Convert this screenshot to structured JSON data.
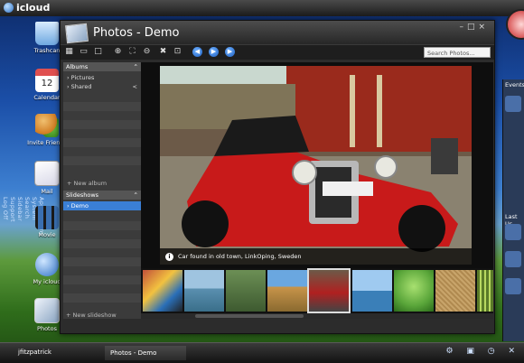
{
  "desktop": {
    "brand": "icloud",
    "vertical_menu": [
      "Applications",
      "System",
      "Search",
      "Sidebar",
      "Support",
      "Log Off"
    ],
    "icons": [
      {
        "name": "trashcan-icon",
        "label": "Trashcan",
        "color": "#6fa8e0"
      },
      {
        "name": "calendar-icon",
        "label": "Calendar",
        "color": "#e05050"
      },
      {
        "name": "invite-friends-icon",
        "label": "Invite Friends",
        "color": "#f0a830"
      },
      {
        "name": "mail-icon",
        "label": "Mail",
        "color": "#eaeaea"
      },
      {
        "name": "movie-icon",
        "label": "Movie",
        "color": "#3a6fb0"
      },
      {
        "name": "my-icloud-icon",
        "label": "My icloud",
        "color": "#4a90d8"
      },
      {
        "name": "photos-icon",
        "label": "Photos",
        "color": "#9cb9e0"
      }
    ]
  },
  "window": {
    "title": "Photos - Demo",
    "controls": [
      "–",
      "□",
      "×"
    ],
    "search_placeholder": "Search Photos...",
    "toolbar_icons": [
      "grid-view-icon",
      "filmstrip-view-icon",
      "single-view-icon",
      "zoom-in-icon",
      "fit-icon",
      "zoom-out-icon",
      "delete-icon",
      "fullscreen-icon",
      "previous-icon",
      "play-icon",
      "next-icon"
    ]
  },
  "sidebar": {
    "albums_header": "Albums",
    "album_items": [
      "Pictures",
      "Shared"
    ],
    "new_album": "+ New album",
    "slideshows_header": "Slideshows",
    "slideshow_items": [
      "Demo"
    ],
    "new_slideshow": "+ New slideshow"
  },
  "viewer": {
    "caption": "Car found in old town, LinkOping, Sweden",
    "info_glyph": "i"
  },
  "filmstrip": {
    "thumb_colors": [
      "#c2503a",
      "#5a8fb0",
      "#6c8f55",
      "#c9954a",
      "#b02020",
      "#3a7fb8",
      "#5aa63a",
      "#c8a46a",
      "#5a7a28"
    ]
  },
  "events_panel": {
    "title": "Events",
    "subtitle": "Last Us"
  },
  "taskbar": {
    "username": "jfitzpatrick",
    "task_label": "Photos - Demo",
    "tray_glyphs": "⚙ ▣ ◷ ✕"
  }
}
